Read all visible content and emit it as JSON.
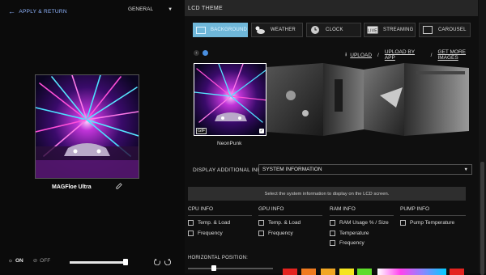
{
  "left": {
    "back_label": "APPLY & RETURN",
    "mode_value": "GENERAL",
    "device_name": "MAGFloe Ultra",
    "toggle_on": "ON",
    "toggle_off": "OFF",
    "brightness_level": 0.95
  },
  "header": {
    "title": "LCD THEME"
  },
  "tabs": [
    {
      "label": "BACKGROUND",
      "icon": "background-icon",
      "active": true
    },
    {
      "label": "WEATHER",
      "icon": "weather-icon",
      "active": false
    },
    {
      "label": "CLOCK",
      "icon": "clock-icon",
      "active": false
    },
    {
      "label": "STREAMING",
      "icon": "live-icon",
      "active": false
    },
    {
      "label": "CAROUSEL",
      "icon": "carousel-icon",
      "active": false
    }
  ],
  "upload": {
    "upload_label": "UPLOAD",
    "sep1": "/",
    "upload_by_app": "UPLOAD BY APP",
    "sep2": "/",
    "get_more": "GET MORE IMAGES"
  },
  "thumbnails": {
    "selected_name": "NeonPunk",
    "gif_badge": "GIF"
  },
  "additional": {
    "label": "DISPLAY ADDITIONAL INFO",
    "selected": "SYSTEM INFORMATION",
    "hint": "Select the system information to display on the LCD screen."
  },
  "info_columns": {
    "cpu": {
      "title": "CPU INFO",
      "items": [
        "Temp. & Load",
        "Frequency"
      ]
    },
    "gpu": {
      "title": "GPU INFO",
      "items": [
        "Temp. & Load",
        "Frequency"
      ]
    },
    "ram": {
      "title": "RAM INFO",
      "items": [
        "RAM Usage % / Size",
        "Temperature",
        "Frequency"
      ]
    },
    "pump": {
      "title": "PUMP INFO",
      "items": [
        "Pump Temperature"
      ]
    }
  },
  "position": {
    "label": "HORIZONTAL POSITION:",
    "level": 0.3
  },
  "colors": {
    "accent": "#4a8fe0",
    "tab_active": "#6fb7d9",
    "swatches": [
      "#e4231f",
      "#f07a1e",
      "#f2a622",
      "#f5e41f",
      "#5fdc2a",
      "#d8d8d8",
      "#e4231f"
    ]
  }
}
